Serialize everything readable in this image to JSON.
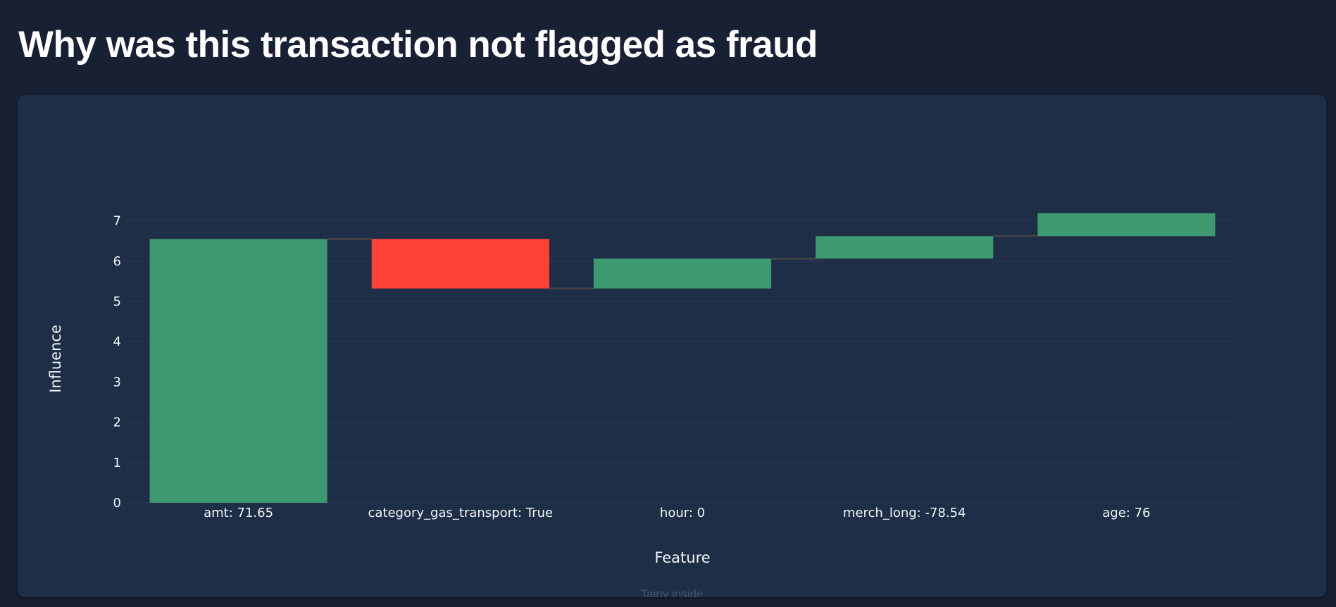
{
  "page": {
    "title": "Why was this transaction not flagged as fraud"
  },
  "footer": {
    "brand": "Taipy inside"
  },
  "colors": {
    "increasing": "#3d9970",
    "decreasing": "#ff4136",
    "connector": "#444444",
    "grid": "#2a3a52",
    "card": "#1e2e46",
    "background": "#172133"
  },
  "chart_data": {
    "type": "waterfall",
    "title": "",
    "xlabel": "Feature",
    "ylabel": "Influence",
    "ylim": [
      0,
      7.15
    ],
    "yticks": [
      0,
      1,
      2,
      3,
      4,
      5,
      6,
      7
    ],
    "grid": true,
    "legend": false,
    "categories": [
      "amt: 71.65",
      "category_gas_transport: True",
      "hour: 0",
      "merch_long: -78.54",
      "age: 76"
    ],
    "values": [
      6.55,
      -1.23,
      0.74,
      0.56,
      0.57
    ],
    "cumulative": [
      6.55,
      5.32,
      6.06,
      6.62,
      7.19
    ]
  }
}
